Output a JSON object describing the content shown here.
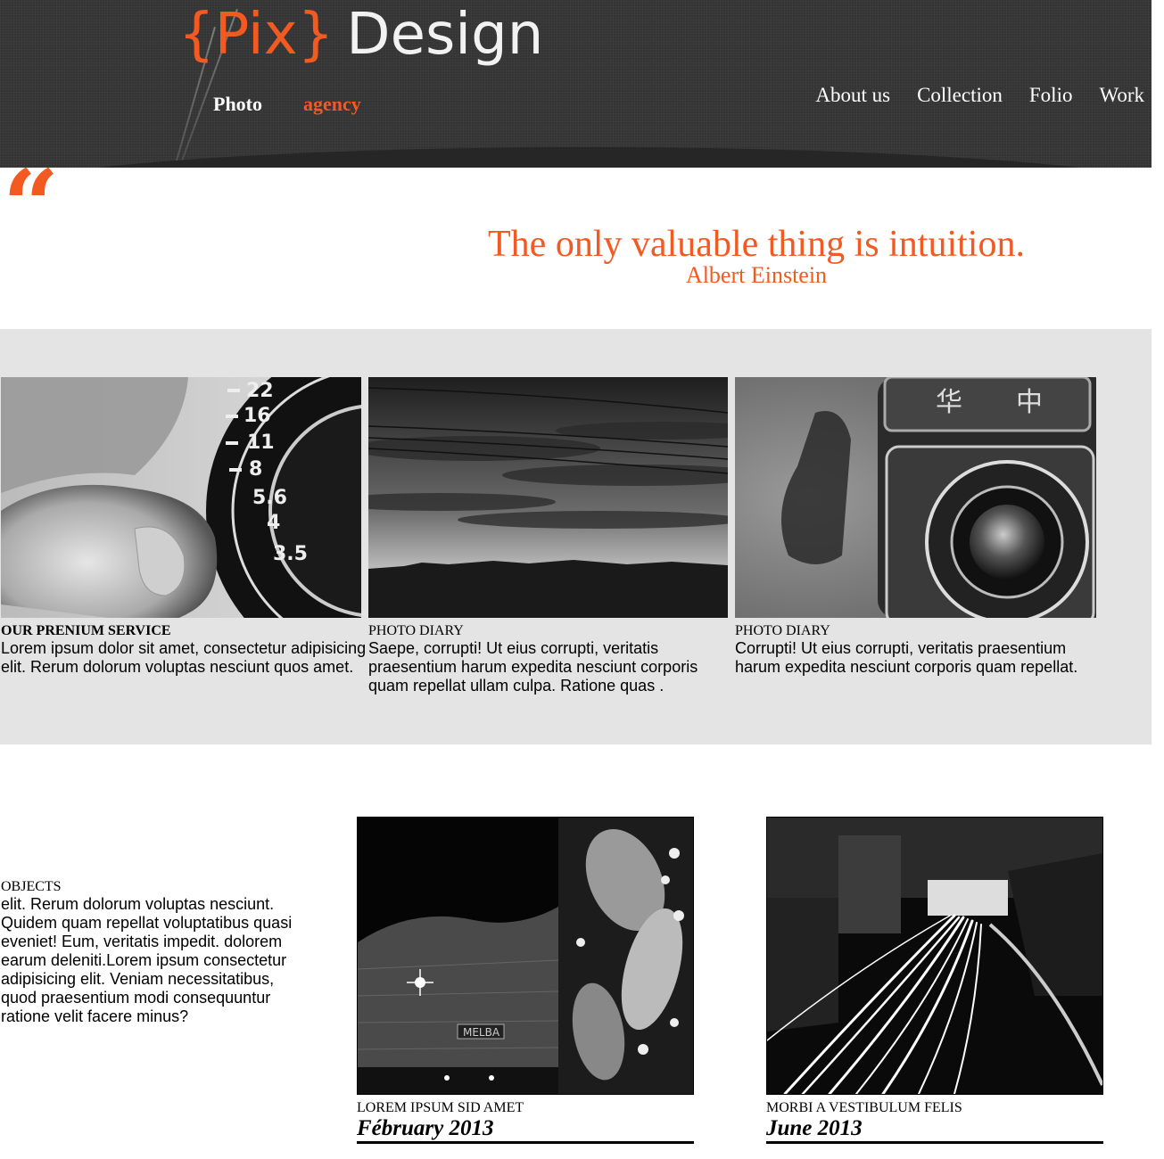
{
  "header": {
    "logo": {
      "brace_open": "{",
      "pix": "Pix",
      "brace_close": "}",
      "design": "Design"
    },
    "tagline": {
      "photo": "Photo",
      "agency": "agency"
    },
    "nav": [
      "About us",
      "Collection",
      "Folio",
      "Work"
    ]
  },
  "quote": {
    "mark": "“",
    "text": "The only valuable thing is intuition.",
    "author": "Albert Einstein"
  },
  "features": [
    {
      "label": "OUR PRENIUM SERVICE",
      "body": "Lorem ipsum dolor sit amet, consectetur adipisicing elit. Rerum dolorum voluptas nesciunt quos amet.",
      "image": "camera-dial-photo"
    },
    {
      "label": "PHOTO DIARY",
      "body": "Saepe, corrupti! Ut eius corrupti, veritatis praesentium harum expedita nesciunt corporis quam repellat ullam culpa. Ratione quas .",
      "image": "sunset-sky-photo"
    },
    {
      "label": "PHOTO DIARY",
      "body": "Corrupti! Ut eius corrupti, veritatis praesentium harum expedita nesciunt corporis quam repellat.",
      "image": "vintage-camera-photo"
    }
  ],
  "objects": {
    "label": "OBJECTS",
    "body": "elit. Rerum dolorum voluptas nesciunt. Quidem quam repellat voluptatibus quasi eveniet! Eum, veritatis impedit. dolorem earum deleniti.Lorem ipsum consectetur adipisicing elit. Veniam necessitatibus, quod praesentium modi consequuntur ratione velit facere minus?"
  },
  "posts": [
    {
      "label": "LOREM IPSUM SID AMET",
      "date": "Fébruary 2013",
      "image": "night-building-photo"
    },
    {
      "label": "MORBI A VESTIBULUM FELIS",
      "date": "June 2013",
      "image": "light-trails-photo"
    }
  ],
  "colors": {
    "accent": "#f25a22",
    "header_bg": "#343434",
    "band_bg": "#e4e4e4"
  }
}
